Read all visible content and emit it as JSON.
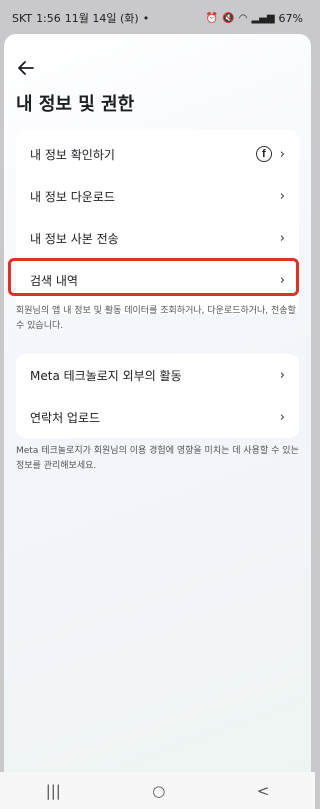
{
  "status": {
    "carrier": "SKT",
    "time": "1:56",
    "date": "11월 14일 (화)",
    "dot": "•",
    "battery": "67%"
  },
  "header": {
    "back_icon": "arrow-left-icon",
    "title": "내 정보 및 권한"
  },
  "card1": {
    "items": [
      {
        "label": "내 정보 확인하기",
        "icon": "facebook-icon"
      },
      {
        "label": "내 정보 다운로드"
      },
      {
        "label": "내 정보 사본 전송"
      },
      {
        "label": "검색 내역"
      }
    ]
  },
  "desc1": "회원님의 앱 내 정보 및 활동 데이터를 조회하거나, 다운로드하거나, 전송할 수 있습니다.",
  "card2": {
    "items": [
      {
        "label": "Meta 테크놀로지 외부의 활동"
      },
      {
        "label": "연락처 업로드"
      }
    ]
  },
  "desc2": "Meta 테크놀로지가 회원님의 이용 경험에 영향을 미치는 데 사용할 수 있는 정보를 관리해보세요.",
  "highlight_color": "#e0302a",
  "nav": {
    "recents": "|||",
    "home": "○",
    "back": "<"
  }
}
